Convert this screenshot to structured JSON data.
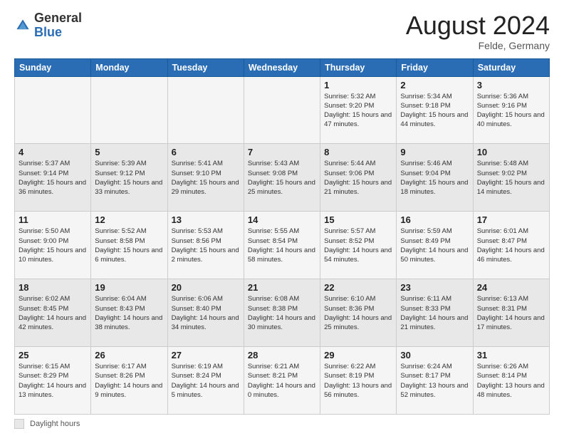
{
  "header": {
    "logo_general": "General",
    "logo_blue": "Blue",
    "month_title": "August 2024",
    "location": "Felde, Germany"
  },
  "footer": {
    "label": "Daylight hours"
  },
  "days_of_week": [
    "Sunday",
    "Monday",
    "Tuesday",
    "Wednesday",
    "Thursday",
    "Friday",
    "Saturday"
  ],
  "weeks": [
    [
      {
        "day": "",
        "info": ""
      },
      {
        "day": "",
        "info": ""
      },
      {
        "day": "",
        "info": ""
      },
      {
        "day": "",
        "info": ""
      },
      {
        "day": "1",
        "info": "Sunrise: 5:32 AM\nSunset: 9:20 PM\nDaylight: 15 hours\nand 47 minutes."
      },
      {
        "day": "2",
        "info": "Sunrise: 5:34 AM\nSunset: 9:18 PM\nDaylight: 15 hours\nand 44 minutes."
      },
      {
        "day": "3",
        "info": "Sunrise: 5:36 AM\nSunset: 9:16 PM\nDaylight: 15 hours\nand 40 minutes."
      }
    ],
    [
      {
        "day": "4",
        "info": "Sunrise: 5:37 AM\nSunset: 9:14 PM\nDaylight: 15 hours\nand 36 minutes."
      },
      {
        "day": "5",
        "info": "Sunrise: 5:39 AM\nSunset: 9:12 PM\nDaylight: 15 hours\nand 33 minutes."
      },
      {
        "day": "6",
        "info": "Sunrise: 5:41 AM\nSunset: 9:10 PM\nDaylight: 15 hours\nand 29 minutes."
      },
      {
        "day": "7",
        "info": "Sunrise: 5:43 AM\nSunset: 9:08 PM\nDaylight: 15 hours\nand 25 minutes."
      },
      {
        "day": "8",
        "info": "Sunrise: 5:44 AM\nSunset: 9:06 PM\nDaylight: 15 hours\nand 21 minutes."
      },
      {
        "day": "9",
        "info": "Sunrise: 5:46 AM\nSunset: 9:04 PM\nDaylight: 15 hours\nand 18 minutes."
      },
      {
        "day": "10",
        "info": "Sunrise: 5:48 AM\nSunset: 9:02 PM\nDaylight: 15 hours\nand 14 minutes."
      }
    ],
    [
      {
        "day": "11",
        "info": "Sunrise: 5:50 AM\nSunset: 9:00 PM\nDaylight: 15 hours\nand 10 minutes."
      },
      {
        "day": "12",
        "info": "Sunrise: 5:52 AM\nSunset: 8:58 PM\nDaylight: 15 hours\nand 6 minutes."
      },
      {
        "day": "13",
        "info": "Sunrise: 5:53 AM\nSunset: 8:56 PM\nDaylight: 15 hours\nand 2 minutes."
      },
      {
        "day": "14",
        "info": "Sunrise: 5:55 AM\nSunset: 8:54 PM\nDaylight: 14 hours\nand 58 minutes."
      },
      {
        "day": "15",
        "info": "Sunrise: 5:57 AM\nSunset: 8:52 PM\nDaylight: 14 hours\nand 54 minutes."
      },
      {
        "day": "16",
        "info": "Sunrise: 5:59 AM\nSunset: 8:49 PM\nDaylight: 14 hours\nand 50 minutes."
      },
      {
        "day": "17",
        "info": "Sunrise: 6:01 AM\nSunset: 8:47 PM\nDaylight: 14 hours\nand 46 minutes."
      }
    ],
    [
      {
        "day": "18",
        "info": "Sunrise: 6:02 AM\nSunset: 8:45 PM\nDaylight: 14 hours\nand 42 minutes."
      },
      {
        "day": "19",
        "info": "Sunrise: 6:04 AM\nSunset: 8:43 PM\nDaylight: 14 hours\nand 38 minutes."
      },
      {
        "day": "20",
        "info": "Sunrise: 6:06 AM\nSunset: 8:40 PM\nDaylight: 14 hours\nand 34 minutes."
      },
      {
        "day": "21",
        "info": "Sunrise: 6:08 AM\nSunset: 8:38 PM\nDaylight: 14 hours\nand 30 minutes."
      },
      {
        "day": "22",
        "info": "Sunrise: 6:10 AM\nSunset: 8:36 PM\nDaylight: 14 hours\nand 25 minutes."
      },
      {
        "day": "23",
        "info": "Sunrise: 6:11 AM\nSunset: 8:33 PM\nDaylight: 14 hours\nand 21 minutes."
      },
      {
        "day": "24",
        "info": "Sunrise: 6:13 AM\nSunset: 8:31 PM\nDaylight: 14 hours\nand 17 minutes."
      }
    ],
    [
      {
        "day": "25",
        "info": "Sunrise: 6:15 AM\nSunset: 8:29 PM\nDaylight: 14 hours\nand 13 minutes."
      },
      {
        "day": "26",
        "info": "Sunrise: 6:17 AM\nSunset: 8:26 PM\nDaylight: 14 hours\nand 9 minutes."
      },
      {
        "day": "27",
        "info": "Sunrise: 6:19 AM\nSunset: 8:24 PM\nDaylight: 14 hours\nand 5 minutes."
      },
      {
        "day": "28",
        "info": "Sunrise: 6:21 AM\nSunset: 8:21 PM\nDaylight: 14 hours\nand 0 minutes."
      },
      {
        "day": "29",
        "info": "Sunrise: 6:22 AM\nSunset: 8:19 PM\nDaylight: 13 hours\nand 56 minutes."
      },
      {
        "day": "30",
        "info": "Sunrise: 6:24 AM\nSunset: 8:17 PM\nDaylight: 13 hours\nand 52 minutes."
      },
      {
        "day": "31",
        "info": "Sunrise: 6:26 AM\nSunset: 8:14 PM\nDaylight: 13 hours\nand 48 minutes."
      }
    ]
  ]
}
